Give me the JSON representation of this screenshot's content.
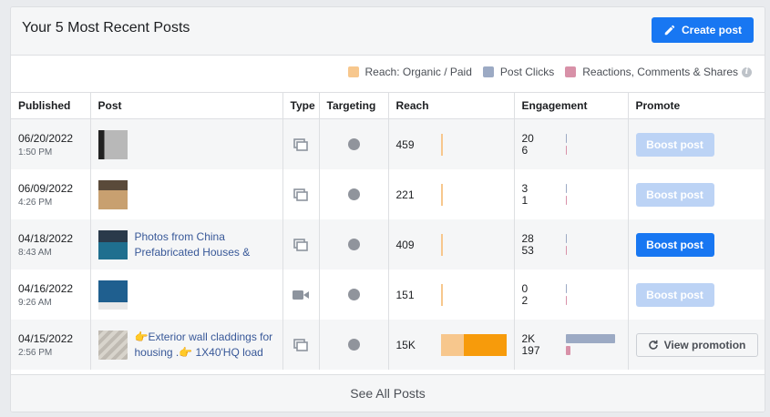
{
  "header": {
    "title": "Your 5 Most Recent Posts",
    "create_label": "Create post"
  },
  "legend": [
    {
      "label": "Reach: Organic / Paid",
      "color": "#f7c78d"
    },
    {
      "label": "Post Clicks",
      "color": "#9caac4"
    },
    {
      "label": "Reactions, Comments & Shares",
      "color": "#d891a8"
    }
  ],
  "columns": [
    "Published",
    "Post",
    "Type",
    "Targeting",
    "Reach",
    "Engagement",
    "Promote"
  ],
  "rows": [
    {
      "date": "06/20/2022",
      "time": "1:50 PM",
      "post_text": "",
      "type": "photo",
      "reach": "459",
      "clicks": "20",
      "reactions": "6",
      "action": "Boost post",
      "action_state": "disabled"
    },
    {
      "date": "06/09/2022",
      "time": "4:26 PM",
      "post_text": "",
      "type": "photo",
      "reach": "221",
      "clicks": "3",
      "reactions": "1",
      "action": "Boost post",
      "action_state": "disabled"
    },
    {
      "date": "04/18/2022",
      "time": "8:43 AM",
      "post_text": "Photos from China Prefabricated Houses &",
      "type": "photo",
      "reach": "409",
      "clicks": "28",
      "reactions": "53",
      "action": "Boost post",
      "action_state": "active"
    },
    {
      "date": "04/16/2022",
      "time": "9:26 AM",
      "post_text": "",
      "type": "video",
      "reach": "151",
      "clicks": "0",
      "reactions": "2",
      "action": "Boost post",
      "action_state": "disabled"
    },
    {
      "date": "04/15/2022",
      "time": "2:56 PM",
      "post_text": "👉Exterior wall claddings for housing .👉 1X40'HQ load",
      "type": "photo",
      "reach": "15K",
      "clicks": "2K",
      "reactions": "197",
      "action": "View promotion",
      "action_state": "view"
    }
  ],
  "footer": {
    "label": "See All Posts"
  },
  "colors": {
    "accent": "#1877f2",
    "organic": "#f7c78d",
    "paid": "#f79b0b",
    "clicks": "#9caac4",
    "reactions": "#d891a8"
  }
}
